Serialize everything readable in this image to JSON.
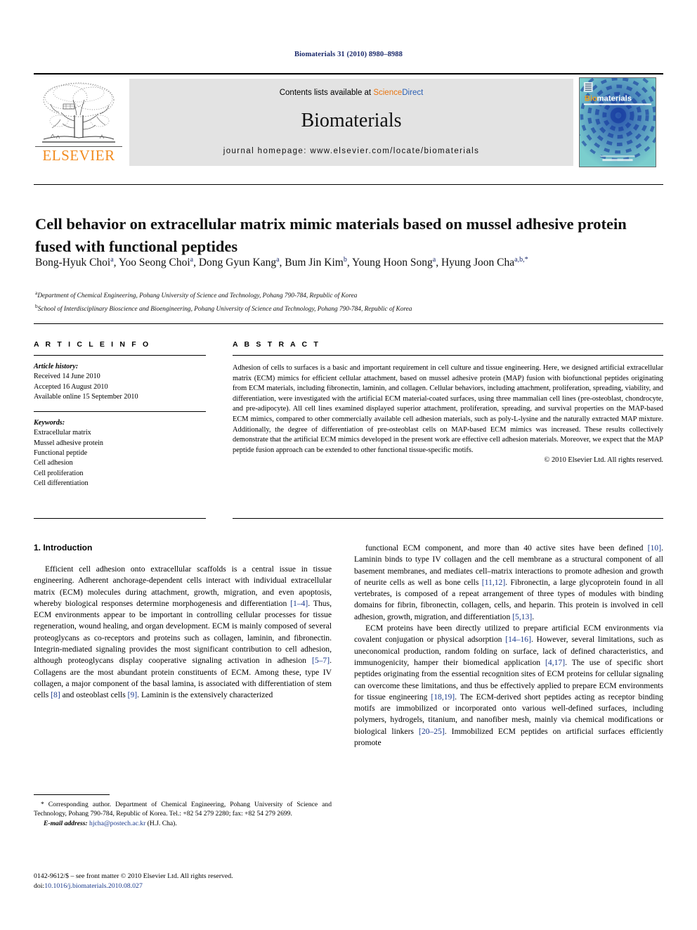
{
  "running_head": "Biomaterials 31 (2010) 8980–8988",
  "masthead": {
    "publisher_name": "ELSEVIER",
    "contents_prefix": "Contents lists available at ",
    "contents_link_science": "Science",
    "contents_link_direct": "Direct",
    "journal_name": "Biomaterials",
    "journal_homepage": "journal homepage: www.elsevier.com/locate/biomaterials",
    "cover_title_bio": "Bio",
    "cover_title_materials": "materials"
  },
  "article": {
    "title": "Cell behavior on extracellular matrix mimic materials based on mussel adhesive protein fused with functional peptides",
    "authors": [
      {
        "name": "Bong-Hyuk Choi",
        "sup": "a",
        "sep": ", "
      },
      {
        "name": "Yoo Seong Choi",
        "sup": "a",
        "sep": ", "
      },
      {
        "name": "Dong Gyun Kang",
        "sup": "a",
        "sep": ", "
      },
      {
        "name": "Bum Jin Kim",
        "sup": "b",
        "sep": ", "
      },
      {
        "name": "Young Hoon Song",
        "sup": "a",
        "sep": ", "
      },
      {
        "name": "Hyung Joon Cha",
        "sup": "a,b,*",
        "sep": ""
      }
    ],
    "affiliations": [
      {
        "mark": "a",
        "text": "Department of Chemical Engineering, Pohang University of Science and Technology, Pohang 790-784, Republic of Korea"
      },
      {
        "mark": "b",
        "text": "School of Interdisciplinary Bioscience and Bioengineering, Pohang University of Science and Technology, Pohang 790-784, Republic of Korea"
      }
    ]
  },
  "article_info": {
    "heading": "A R T I C L E  I N F O",
    "history_label": "Article history:",
    "history": [
      "Received 14 June 2010",
      "Accepted 16 August 2010",
      "Available online 15 September 2010"
    ],
    "keywords_label": "Keywords:",
    "keywords": [
      "Extracellular matrix",
      "Mussel adhesive protein",
      "Functional peptide",
      "Cell adhesion",
      "Cell proliferation",
      "Cell differentiation"
    ]
  },
  "abstract": {
    "heading": "A B S T R A C T",
    "body": "Adhesion of cells to surfaces is a basic and important requirement in cell culture and tissue engineering. Here, we designed artificial extracellular matrix (ECM) mimics for efficient cellular attachment, based on mussel adhesive protein (MAP) fusion with biofunctional peptides originating from ECM materials, including fibronectin, laminin, and collagen. Cellular behaviors, including attachment, proliferation, spreading, viability, and differentiation, were investigated with the artificial ECM material-coated surfaces, using three mammalian cell lines (pre-osteoblast, chondrocyte, and pre-adipocyte). All cell lines examined displayed superior attachment, proliferation, spreading, and survival properties on the MAP-based ECM mimics, compared to other commercially available cell adhesion materials, such as poly-L-lysine and the naturally extracted MAP mixture. Additionally, the degree of differentiation of pre-osteoblast cells on MAP-based ECM mimics was increased. These results collectively demonstrate that the artificial ECM mimics developed in the present work are effective cell adhesion materials. Moreover, we expect that the MAP peptide fusion approach can be extended to other functional tissue-specific motifs.",
    "copyright": "© 2010 Elsevier Ltd. All rights reserved."
  },
  "introduction": {
    "heading": "1. Introduction",
    "left_paragraphs": [
      "Efficient cell adhesion onto extracellular scaffolds is a central issue in tissue engineering. Adherent anchorage-dependent cells interact with individual extracellular matrix (ECM) molecules during attachment, growth, migration, and even apoptosis, whereby biological responses determine morphogenesis and differentiation [1–4]. Thus, ECM environments appear to be important in controlling cellular processes for tissue regeneration, wound healing, and organ development. ECM is mainly composed of several proteoglycans as co-receptors and proteins such as collagen, laminin, and fibronectin. Integrin-mediated signaling provides the most significant contribution to cell adhesion, although proteoglycans display cooperative signaling activation in adhesion [5–7]. Collagens are the most abundant protein constituents of ECM. Among these, type IV collagen, a major component of the basal lamina, is associated with differentiation of stem cells [8] and osteoblast cells [9]. Laminin is the extensively characterized"
    ],
    "right_paragraphs": [
      "functional ECM component, and more than 40 active sites have been defined [10]. Laminin binds to type IV collagen and the cell membrane as a structural component of all basement membranes, and mediates cell–matrix interactions to promote adhesion and growth of neurite cells as well as bone cells [11,12]. Fibronectin, a large glycoprotein found in all vertebrates, is composed of a repeat arrangement of three types of modules with binding domains for fibrin, fibronectin, collagen, cells, and heparin. This protein is involved in cell adhesion, growth, migration, and differentiation [5,13].",
      "ECM proteins have been directly utilized to prepare artificial ECM environments via covalent conjugation or physical adsorption [14–16]. However, several limitations, such as uneconomical production, random folding on surface, lack of defined characteristics, and immunogenicity, hamper their biomedical application [4,17]. The use of specific short peptides originating from the essential recognition sites of ECM proteins for cellular signaling can overcome these limitations, and thus be effectively applied to prepare ECM environments for tissue engineering [18,19]. The ECM-derived short peptides acting as receptor binding motifs are immobilized or incorporated onto various well-defined surfaces, including polymers, hydrogels, titanium, and nanofiber mesh, mainly via chemical modifications or biological linkers [20–25]. Immobilized ECM peptides on artificial surfaces efficiently promote"
    ]
  },
  "footnotes": {
    "corresponding": "* Corresponding author. Department of Chemical Engineering, Pohang University of Science and Technology, Pohang 790-784, Republic of Korea. Tel.: +82 54 279 2280; fax: +82 54 279 2699.",
    "email_label": "E-mail address:",
    "email": "hjcha@postech.ac.kr",
    "email_suffix": " (H.J. Cha).",
    "imprint": "0142-9612/$ – see front matter © 2010 Elsevier Ltd. All rights reserved.",
    "doi_label": "doi:",
    "doi": "10.1016/j.biomaterials.2010.08.027"
  }
}
